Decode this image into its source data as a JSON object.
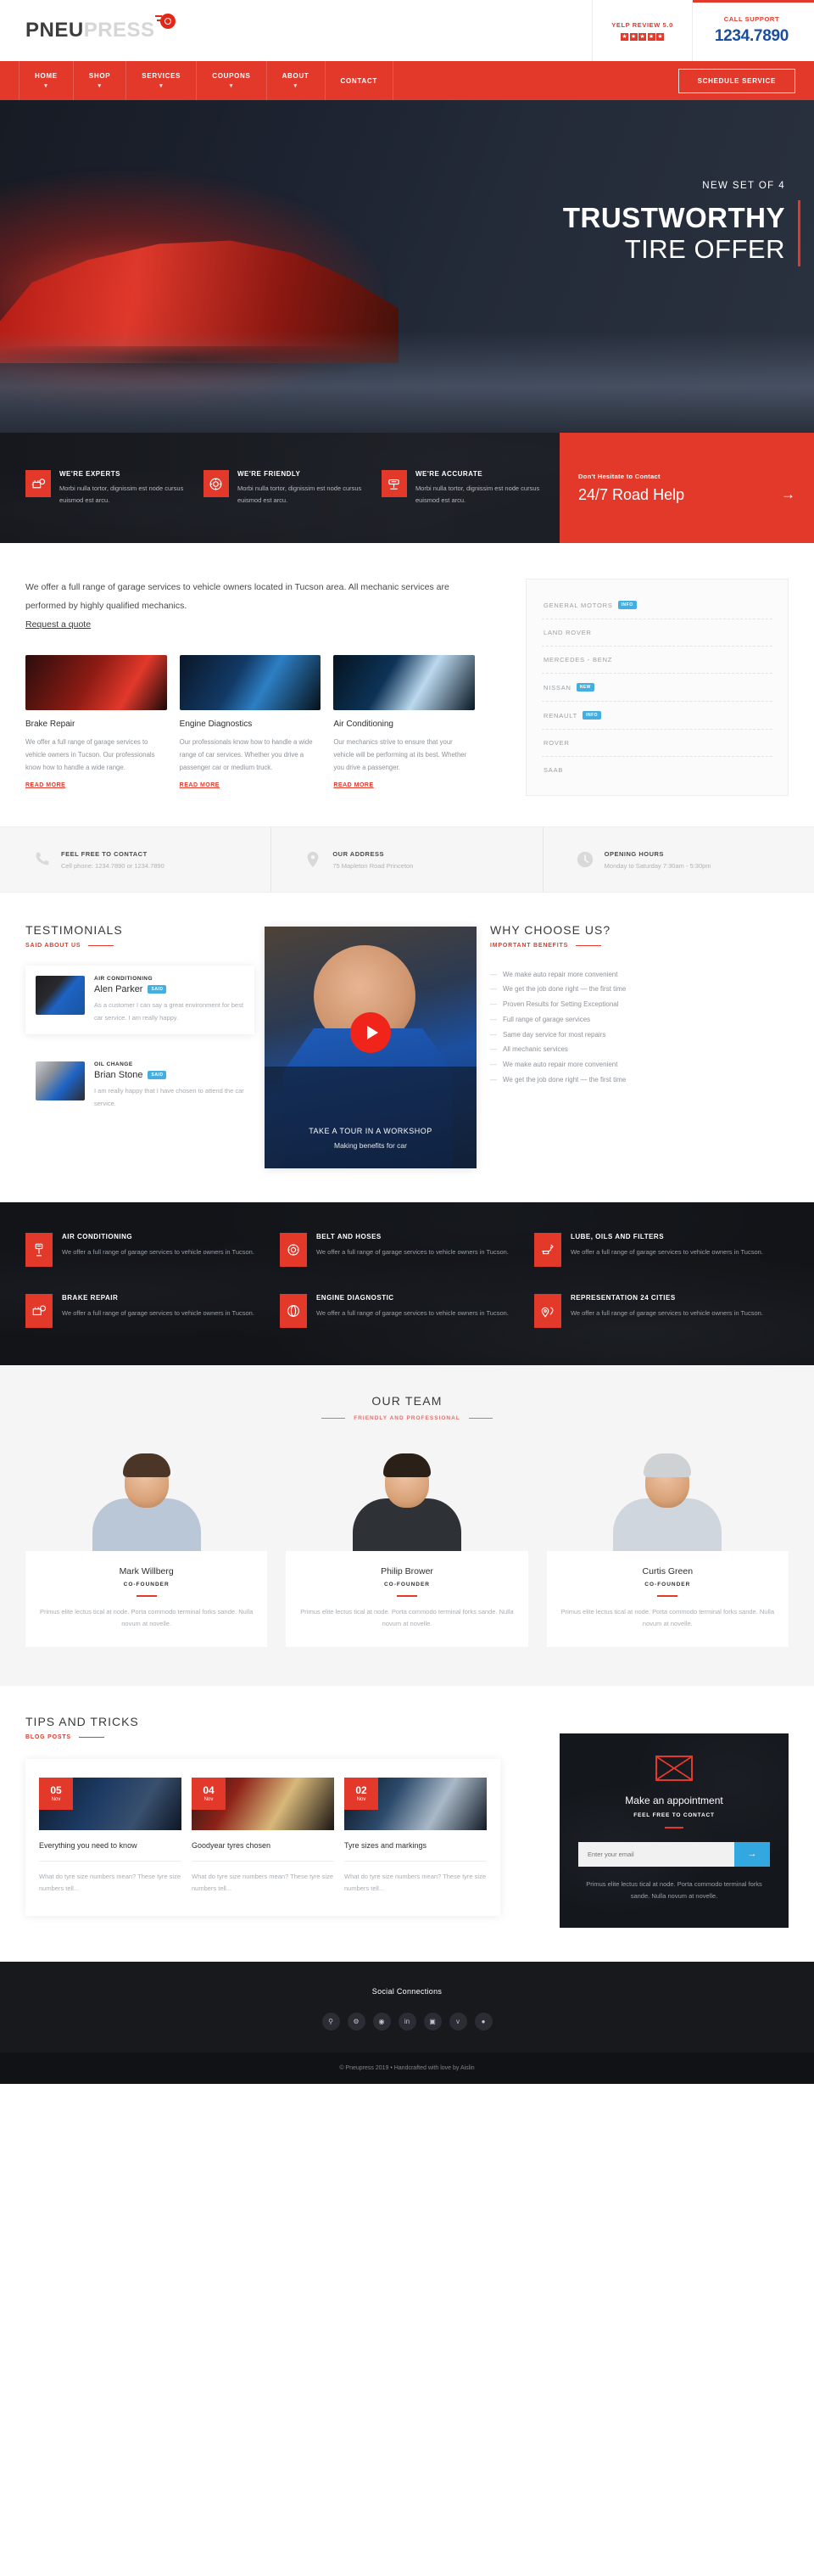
{
  "brand": {
    "name_a": "PNEU",
    "name_b": "PRESS",
    "logo_icon": "tire-icon"
  },
  "topbar": {
    "yelp_label": "YELP REVIEW 5.0",
    "stars": [
      "star",
      "star",
      "star",
      "star",
      "star"
    ],
    "call_label": "CALL SUPPORT",
    "phone": "1234.7890"
  },
  "nav": {
    "items": [
      {
        "label": "HOME",
        "has_dropdown": true
      },
      {
        "label": "SHOP",
        "has_dropdown": true
      },
      {
        "label": "SERVICES",
        "has_dropdown": true
      },
      {
        "label": "COUPONS",
        "has_dropdown": true
      },
      {
        "label": "ABOUT",
        "has_dropdown": true
      },
      {
        "label": "CONTACT",
        "has_dropdown": false
      }
    ],
    "cta": "SCHEDULE SERVICE"
  },
  "hero": {
    "kicker": "NEW SET OF 4",
    "title1": "TRUSTWORTHY",
    "title2": "TIRE OFFER"
  },
  "features": [
    {
      "icon": "engine-gear-icon",
      "title": "WE'RE EXPERTS",
      "desc": "Morbi nulla tortor, dignissim est node cursus euismod est arcu."
    },
    {
      "icon": "brake-disc-icon",
      "title": "WE'RE FRIENDLY",
      "desc": "Morbi nulla tortor, dignissim est node cursus euismod est arcu."
    },
    {
      "icon": "car-lift-icon",
      "title": "WE'RE ACCURATE",
      "desc": "Morbi nulla tortor, dignissim est node cursus euismod est arcu."
    }
  ],
  "road_help": {
    "small": "Don't Hesitate to Contact",
    "big": "24/7 Road Help",
    "arrow": "→"
  },
  "intro": {
    "paragraph": "We offer a full range of garage services to vehicle owners located in Tucson area. All mechanic services are performed by highly qualified mechanics.",
    "link": "Request a quote"
  },
  "services": [
    {
      "title": "Brake Repair",
      "desc": "We offer a full range of garage services to vehicle owners in Tucson. Our professionals know how to handle a wide range.",
      "more": "READ MORE"
    },
    {
      "title": "Engine Diagnostics",
      "desc": "Our professionals know how to handle a wide range of car services. Whether you drive a passenger car or medium truck.",
      "more": "READ MORE"
    },
    {
      "title": "Air Conditioning",
      "desc": "Our mechanics strive to ensure that your vehicle will be performing at its best. Whether you drive a passenger.",
      "more": "READ MORE"
    }
  ],
  "brands": [
    {
      "name": "GENERAL MOTORS",
      "tag": "INFO"
    },
    {
      "name": "LAND ROVER",
      "tag": ""
    },
    {
      "name": "MERCEDES - BENZ",
      "tag": ""
    },
    {
      "name": "NISSAN",
      "tag": "NEW"
    },
    {
      "name": "RENAULT",
      "tag": "INFO"
    },
    {
      "name": "ROVER",
      "tag": ""
    },
    {
      "name": "SAAB",
      "tag": ""
    }
  ],
  "contact_strip": [
    {
      "icon": "phone-icon",
      "title": "FEEL FREE TO CONTACT",
      "desc": "Cell phone: 1234.7890 or 1234.7890"
    },
    {
      "icon": "map-pin-icon",
      "title": "OUR ADDRESS",
      "desc": "75 Mapleton Road Princeton"
    },
    {
      "icon": "clock-icon",
      "title": "OPENING HOURS",
      "desc": "Monday to Saturday 7:30am - 5:30pm"
    }
  ],
  "testimonials": {
    "heading": "TESTIMONIALS",
    "subheading": "SAID ABOUT US",
    "items": [
      {
        "service": "AIR CONDITIONING",
        "name": "Alen Parker",
        "tag": "SAID",
        "text": "As a customer I can say a great environment for best car service. I am really happy."
      },
      {
        "service": "OIL CHANGE",
        "name": "Brian Stone",
        "tag": "SAID",
        "text": "I am really happy that I have chosen to attend the car service."
      }
    ]
  },
  "video": {
    "caption1": "TAKE A TOUR IN A WORKSHOP",
    "caption2": "Making benefits for car",
    "play_icon": "play-icon"
  },
  "why": {
    "heading": "WHY CHOOSE US?",
    "subheading": "IMPORTANT BENEFITS",
    "items": [
      "We make auto repair more convenient",
      "We get the job done right — the first time",
      "Proven Results for Setting Exceptional",
      "Full range of garage services",
      "Same day service for most repairs",
      "All mechanic services",
      "We make auto repair more convenient",
      "We get the job done right — the first time"
    ]
  },
  "dark_services": [
    {
      "icon": "ac-icon",
      "title": "AIR CONDITIONING",
      "desc": "We offer a full range of garage services to vehicle owners in Tucson."
    },
    {
      "icon": "belt-icon",
      "title": "BELT AND HOSES",
      "desc": "We offer a full range of garage services to vehicle owners in Tucson."
    },
    {
      "icon": "oil-filter-icon",
      "title": "LUBE, OILS AND FILTERS",
      "desc": "We offer a full range of garage services to vehicle owners in Tucson."
    },
    {
      "icon": "brake-icon",
      "title": "BRAKE REPAIR",
      "desc": "We offer a full range of garage services to vehicle owners in Tucson."
    },
    {
      "icon": "engine-icon",
      "title": "ENGINE DIAGNOSTIC",
      "desc": "We offer a full range of garage services to vehicle owners in Tucson."
    },
    {
      "icon": "cities-icon",
      "title": "REPRESENTATION 24 CITIES",
      "desc": "We offer a full range of garage services to vehicle owners in Tucson."
    }
  ],
  "team": {
    "heading": "OUR TEAM",
    "subheading": "FRIENDLY AND PROFESSIONAL",
    "members": [
      {
        "name": "Mark Willberg",
        "role": "CO-FOUNDER",
        "bio": "Primus elite lectus tical at node. Porta commodo terminal forks sande. Nulla novum at novelle."
      },
      {
        "name": "Philip Brower",
        "role": "CO-FOUNDER",
        "bio": "Primus elite lectus tical at node. Porta commodo terminal forks sande. Nulla novum at novelle."
      },
      {
        "name": "Curtis Green",
        "role": "CO-FOUNDER",
        "bio": "Primus elite lectus tical at node. Porta commodo terminal forks sande. Nulla novum at novelle."
      }
    ]
  },
  "blog": {
    "heading": "TIPS AND TRICKS",
    "subheading": "BLOG POSTS",
    "posts": [
      {
        "day": "05",
        "month": "Nov",
        "title": "Everything you need to know",
        "excerpt": "What do tyre size numbers mean? These tyre size numbers tell..."
      },
      {
        "day": "04",
        "month": "Nov",
        "title": "Goodyear tyres chosen",
        "excerpt": "What do tyre size numbers mean? These tyre size numbers tell..."
      },
      {
        "day": "02",
        "month": "Nov",
        "title": "Tyre sizes and markings",
        "excerpt": "What do tyre size numbers mean? These tyre size numbers tell..."
      }
    ]
  },
  "appointment": {
    "icon": "envelope-icon",
    "heading": "Make an appointment",
    "subheading": "FEEL FREE TO CONTACT",
    "email_placeholder": "Enter your email",
    "email_value": "",
    "submit_icon": "→",
    "note": "Primus elite lectus tical at node. Porta commodo terminal forks sande. Nulla novum at novelle."
  },
  "footer": {
    "heading": "Social Connections",
    "socials": [
      "search-icon",
      "gear-icon",
      "rss-icon",
      "linkedin-icon",
      "instagram-icon",
      "vimeo-icon",
      "dribbble-icon"
    ],
    "copyright": "© Pneupress 2019 • Handcrafted with love by Aislin"
  }
}
